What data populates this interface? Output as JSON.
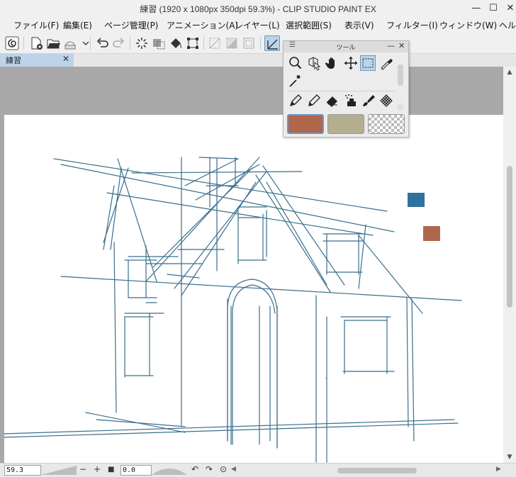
{
  "window": {
    "title": "練習 (1920 x 1080px 350dpi 59.3%)  - CLIP STUDIO PAINT EX",
    "minimize_glyph": "—",
    "maximize_glyph": "☐",
    "close_glyph": "✕"
  },
  "menu": [
    {
      "label": "ファイル(F)"
    },
    {
      "label": "編集(E)"
    },
    {
      "label": "ページ管理(P)"
    },
    {
      "label": "アニメーション(A)"
    },
    {
      "label": "レイヤー(L)"
    },
    {
      "label": "選択範囲(S)"
    },
    {
      "label": "表示(V)"
    },
    {
      "label": "フィルター(I)"
    },
    {
      "label": "ウィンドウ(W)"
    },
    {
      "label": "ヘル"
    }
  ],
  "document_tab": {
    "label": "練習",
    "close_glyph": "✕"
  },
  "tool_palette": {
    "title": "ツール",
    "menu_glyph": "☰",
    "minimize_glyph": "—",
    "close_glyph": "✕",
    "selected_tool": "rect-selection",
    "main_color": "#b0664a",
    "sub_color": "#b4ae90",
    "transparent_label": "transparent"
  },
  "canvas": {
    "paper_color": "#ffffff",
    "stroke_color": "#3a6e8c",
    "swatch_blue": "#2e72a0",
    "swatch_brown": "#b0664a"
  },
  "status_bar": {
    "zoom_value": "59.3",
    "minus_glyph": "−",
    "plus_glyph": "+",
    "stop_glyph": "■",
    "angle_value": "0.0",
    "rotate_left_glyph": "↶",
    "rotate_right_glyph": "↷",
    "reset_glyph": "⊙",
    "scroll_left_glyph": "◀",
    "scroll_right_glyph": "▶"
  },
  "vscroll": {
    "up_glyph": "▲",
    "down_glyph": "▼"
  }
}
